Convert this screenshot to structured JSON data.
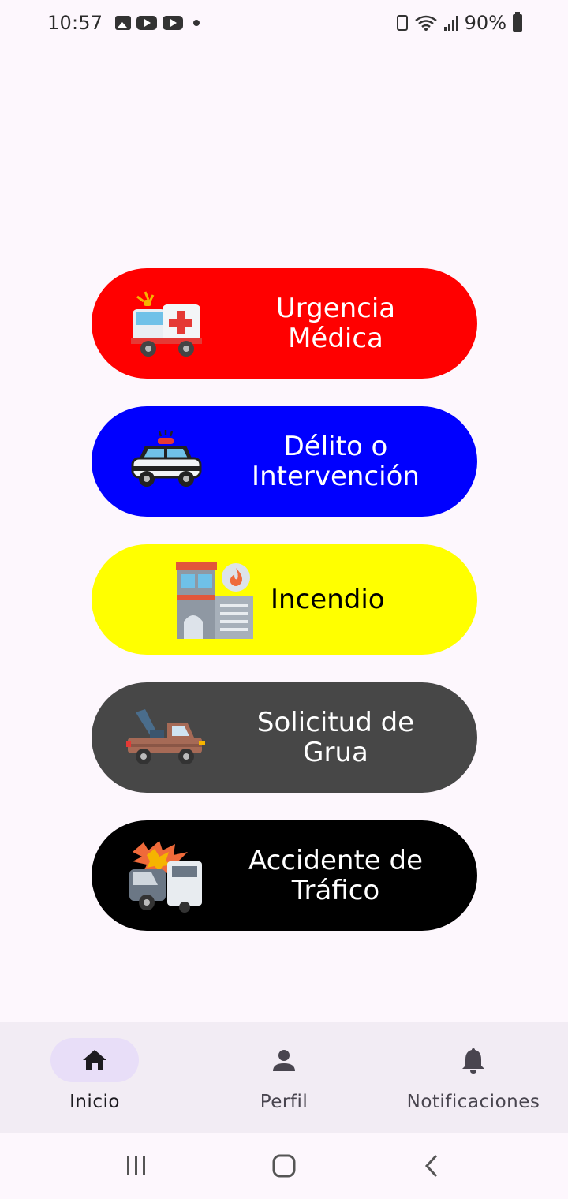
{
  "status_bar": {
    "time": "10:57",
    "battery": "90%"
  },
  "buttons": [
    {
      "id": "medical",
      "label": "Urgencia\nMédica",
      "color": "#ff0000",
      "text_color": "#ffffff",
      "icon": "ambulance-icon"
    },
    {
      "id": "crime",
      "label": "Délito o\nIntervención",
      "color": "#0000ff",
      "text_color": "#ffffff",
      "icon": "police-car-icon"
    },
    {
      "id": "fire",
      "label": "Incendio",
      "color": "#ffff00",
      "text_color": "#000000",
      "icon": "burning-building-icon"
    },
    {
      "id": "tow",
      "label": "Solicitud de\nGrua",
      "color": "#474747",
      "text_color": "#ffffff",
      "icon": "tow-truck-icon"
    },
    {
      "id": "accident",
      "label": "Accidente de\nTráfico",
      "color": "#000000",
      "text_color": "#ffffff",
      "icon": "car-crash-icon"
    }
  ],
  "bottom_nav": {
    "items": [
      {
        "label": "Inicio",
        "icon": "home-icon",
        "active": true
      },
      {
        "label": "Perfil",
        "icon": "person-icon",
        "active": false
      },
      {
        "label": "Notificaciones",
        "icon": "bell-icon",
        "active": false
      }
    ]
  },
  "theme": {
    "background": "#fdf7fd",
    "nav_background": "#f2ecf4",
    "nav_active_pill": "#e8def8"
  }
}
